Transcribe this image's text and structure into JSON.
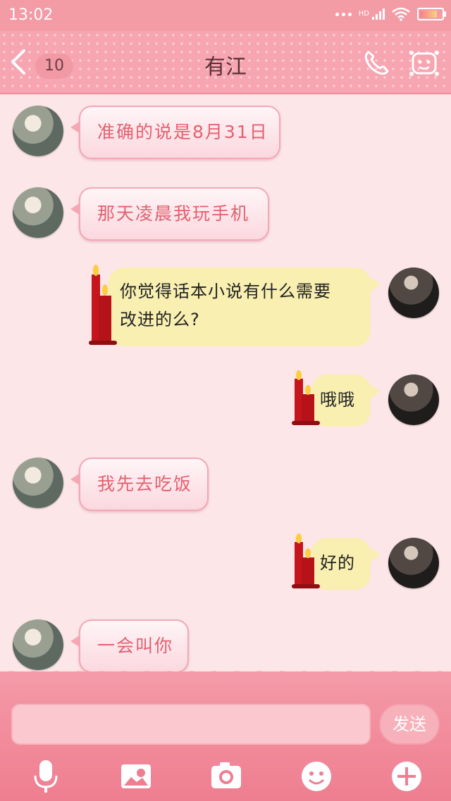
{
  "status_bar": {
    "time": "13:02",
    "network": "HD"
  },
  "header": {
    "unread_count": "10",
    "contact_name": "有江"
  },
  "messages": [
    {
      "side": "in",
      "text": "准确的说是8月31日"
    },
    {
      "side": "in",
      "text": "那天凌晨我玩手机"
    },
    {
      "side": "out",
      "line1": "你觉得话本小说有什么需要",
      "line2": "改进的么?"
    },
    {
      "side": "out",
      "text": "哦哦"
    },
    {
      "side": "in",
      "text": "我先去吃饭"
    },
    {
      "side": "out",
      "text": "好的"
    },
    {
      "side": "in",
      "text": "一会叫你"
    }
  ],
  "composer": {
    "input_value": "",
    "send_label": "发送"
  },
  "toolbar": {
    "icons": [
      "microphone-icon",
      "image-icon",
      "camera-icon",
      "emoji-icon",
      "plus-icon"
    ]
  },
  "colors": {
    "header": "#f7a5b1",
    "chat_bg": "#fce6e8",
    "incoming_text": "#e4606f",
    "outgoing_bubble": "#f8efb1"
  }
}
